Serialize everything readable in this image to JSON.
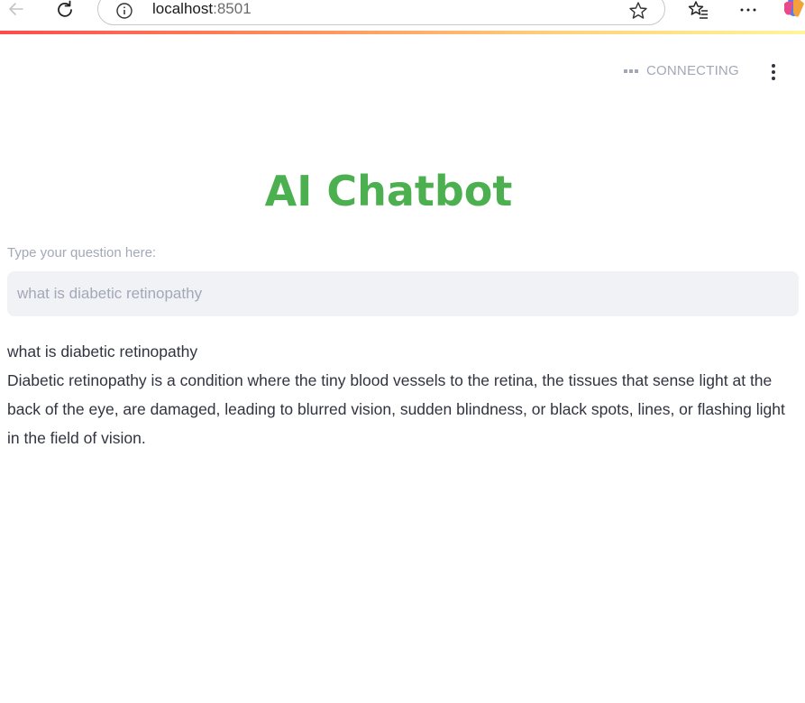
{
  "browser": {
    "url_host": "localhost",
    "url_port": ":8501"
  },
  "header": {
    "status_text": "CONNECTING"
  },
  "main": {
    "title": "AI Chatbot",
    "input_label": "Type your question here:",
    "input_value": "what is diabetic retinopathy",
    "chat": {
      "question": "what is diabetic retinopathy",
      "answer": "Diabetic retinopathy is a condition where the tiny blood vessels to the retina, the tissues that sense light at the back of the eye, are damaged, leading to blurred vision, sudden blindness, or black spots, lines, or flashing light in the field of vision."
    }
  },
  "colors": {
    "title": "#4caf50",
    "status": "#a3a8b8",
    "body_text": "#31333f",
    "input_bg": "#f0f2f6",
    "accent_start": "#ff4b4b",
    "accent_end": "#fff59a"
  }
}
